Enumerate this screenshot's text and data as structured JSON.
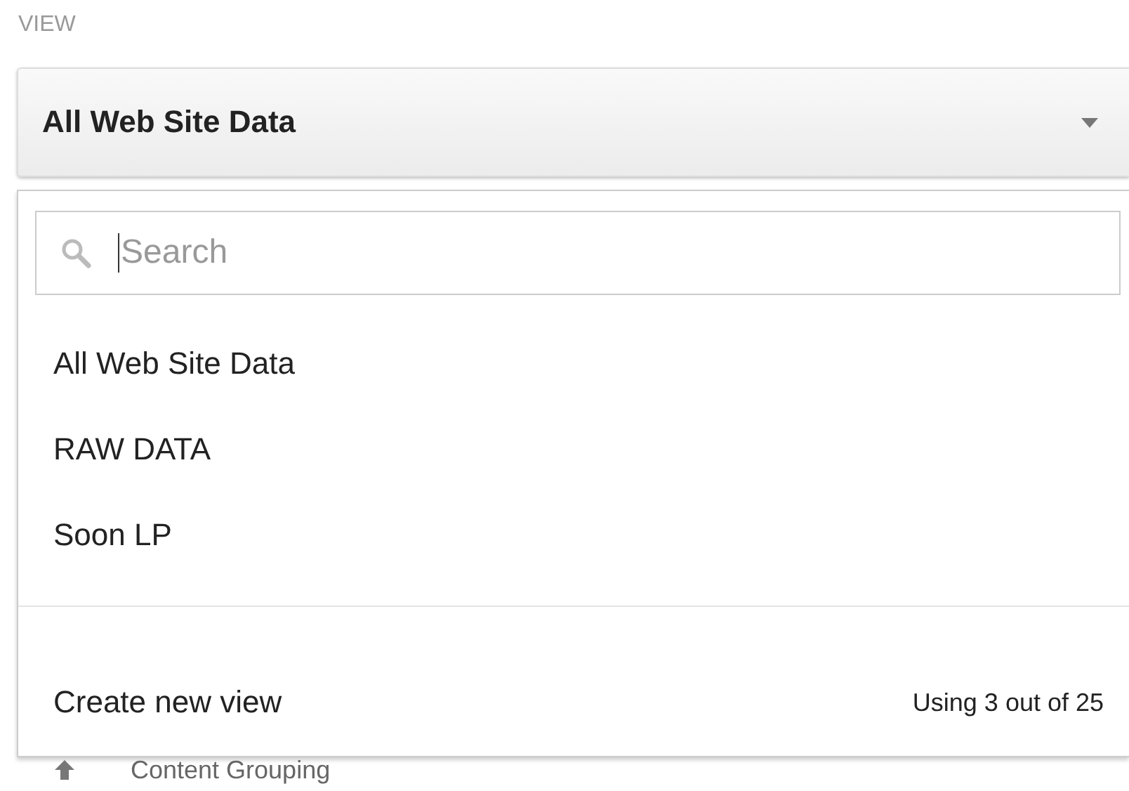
{
  "section_label": "VIEW",
  "view_select": {
    "value": "All Web Site Data"
  },
  "dropdown": {
    "search": {
      "placeholder": "Search"
    },
    "items": [
      {
        "label": "All Web Site Data"
      },
      {
        "label": "RAW DATA"
      },
      {
        "label": "Soon LP"
      }
    ],
    "footer": {
      "action": "Create new view",
      "usage": "Using 3 out of 25"
    }
  },
  "behind": {
    "label": "Content Grouping"
  }
}
